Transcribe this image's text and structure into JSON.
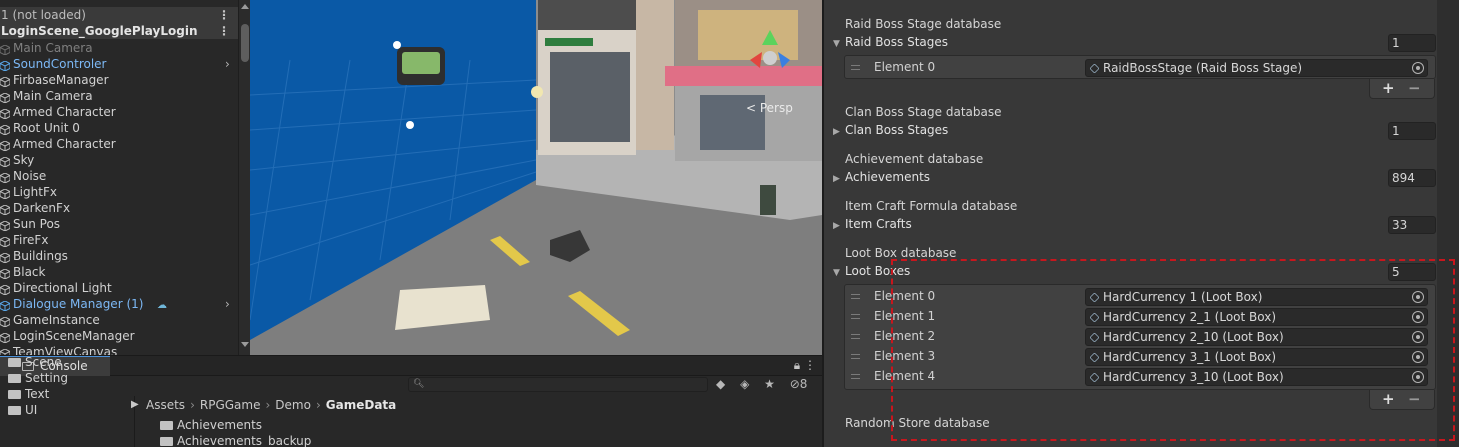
{
  "hierarchy": {
    "scene_rows": [
      {
        "label": "1 (not loaded)"
      },
      {
        "label": "LoginScene_GooglePlayLogin"
      }
    ],
    "items": [
      {
        "label": "Main Camera",
        "state": "disabled"
      },
      {
        "label": "SoundControler",
        "state": "prefab",
        "has_children": true
      },
      {
        "label": "FirbaseManager",
        "state": "normal"
      },
      {
        "label": "Main Camera",
        "state": "normal"
      },
      {
        "label": "Armed Character",
        "state": "normal"
      },
      {
        "label": "Root Unit 0",
        "state": "normal"
      },
      {
        "label": "Armed Character",
        "state": "normal"
      },
      {
        "label": "Sky",
        "state": "normal"
      },
      {
        "label": "Noise",
        "state": "normal"
      },
      {
        "label": "LightFx",
        "state": "normal"
      },
      {
        "label": "DarkenFx",
        "state": "normal"
      },
      {
        "label": "Sun Pos",
        "state": "normal"
      },
      {
        "label": "FireFx",
        "state": "normal"
      },
      {
        "label": "Buildings",
        "state": "normal"
      },
      {
        "label": "Black",
        "state": "normal"
      },
      {
        "label": "Directional Light",
        "state": "normal"
      },
      {
        "label": "Dialogue Manager (1)",
        "state": "prefab",
        "has_children": true
      },
      {
        "label": "GameInstance",
        "state": "normal"
      },
      {
        "label": "LoginSceneManager",
        "state": "normal"
      },
      {
        "label": "TeamViewCanvas",
        "state": "normal"
      }
    ]
  },
  "scene_view": {
    "shading_mode": "Shaded",
    "camera_label": "< Persp"
  },
  "console": {
    "tab_label": "Console",
    "hidden_count": "8",
    "left_tree": [
      "Scene",
      "Setting",
      "Text",
      "UI"
    ],
    "breadcrumb": [
      "Assets",
      "RPGGame",
      "Demo",
      "GameData"
    ],
    "files": [
      "Achievements",
      "Achievements_backup"
    ]
  },
  "inspector": {
    "sections": [
      {
        "db_label": "Raid Boss Stage database",
        "fold_label": "Raid Boss Stages",
        "expanded": true,
        "count": "1",
        "elements": [
          {
            "label": "Element 0",
            "ref": "RaidBossStage (Raid Boss Stage)"
          }
        ]
      },
      {
        "db_label": "Clan Boss Stage database",
        "fold_label": "Clan Boss Stages",
        "expanded": false,
        "count": "1",
        "elements": []
      },
      {
        "db_label": "Achievement database",
        "fold_label": "Achievements",
        "expanded": false,
        "count": "894",
        "elements": []
      },
      {
        "db_label": "Item Craft Formula database",
        "fold_label": "Item Crafts",
        "expanded": false,
        "count": "33",
        "elements": []
      },
      {
        "db_label": "Loot Box database",
        "fold_label": "Loot Boxes",
        "expanded": true,
        "count": "5",
        "elements": [
          {
            "label": "Element 0",
            "ref": "HardCurrency 1 (Loot Box)"
          },
          {
            "label": "Element 1",
            "ref": "HardCurrency 2_1 (Loot Box)"
          },
          {
            "label": "Element 2",
            "ref": "HardCurrency 2_10 (Loot Box)"
          },
          {
            "label": "Element 3",
            "ref": "HardCurrency 3_1 (Loot Box)"
          },
          {
            "label": "Element 4",
            "ref": "HardCurrency 3_10 (Loot Box)"
          }
        ]
      }
    ],
    "next_section_label": "Random Store database",
    "add_symbol": "+",
    "remove_symbol": "−",
    "highlight_color": "#c8161d"
  }
}
